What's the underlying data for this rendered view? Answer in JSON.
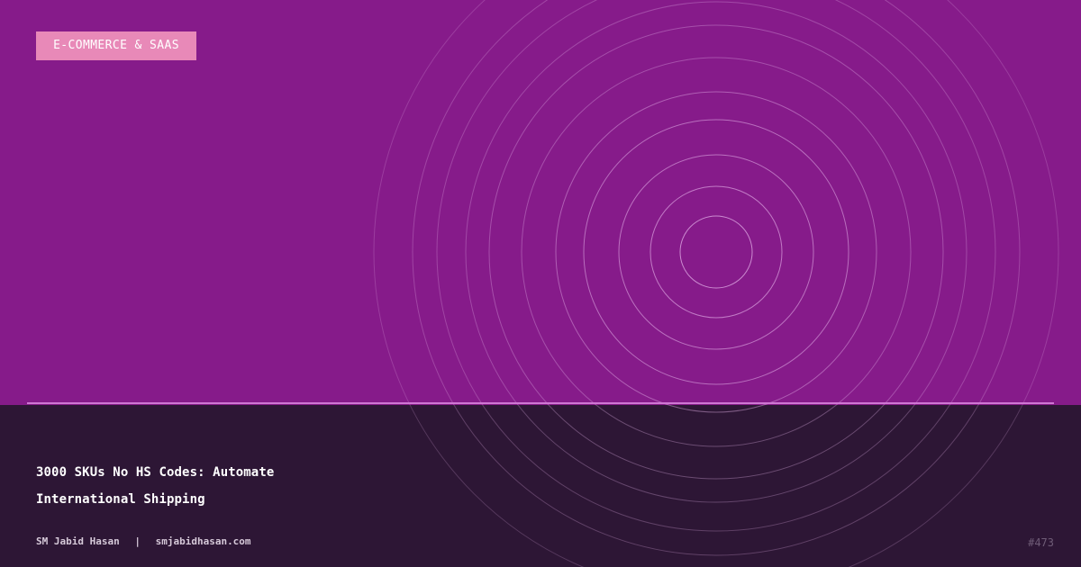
{
  "badge": {
    "label": "E-COMMERCE & SAAS"
  },
  "title": {
    "lines": [
      "3000 SKUs No HS Codes: Automate",
      "International Shipping"
    ]
  },
  "byline": {
    "author": "SM Jabid Hasan",
    "separator": "|",
    "site": "smjabidhasan.com"
  },
  "post": {
    "number": "#473"
  },
  "colors": {
    "top_panel": "#861b8a",
    "bottom_panel": "#2d1635",
    "badge_bg": "#e889b8",
    "divider": "#cf77d3",
    "ring_stroke": "#e6b5eb"
  },
  "decoration": {
    "type": "concentric-rings",
    "count": 14
  }
}
